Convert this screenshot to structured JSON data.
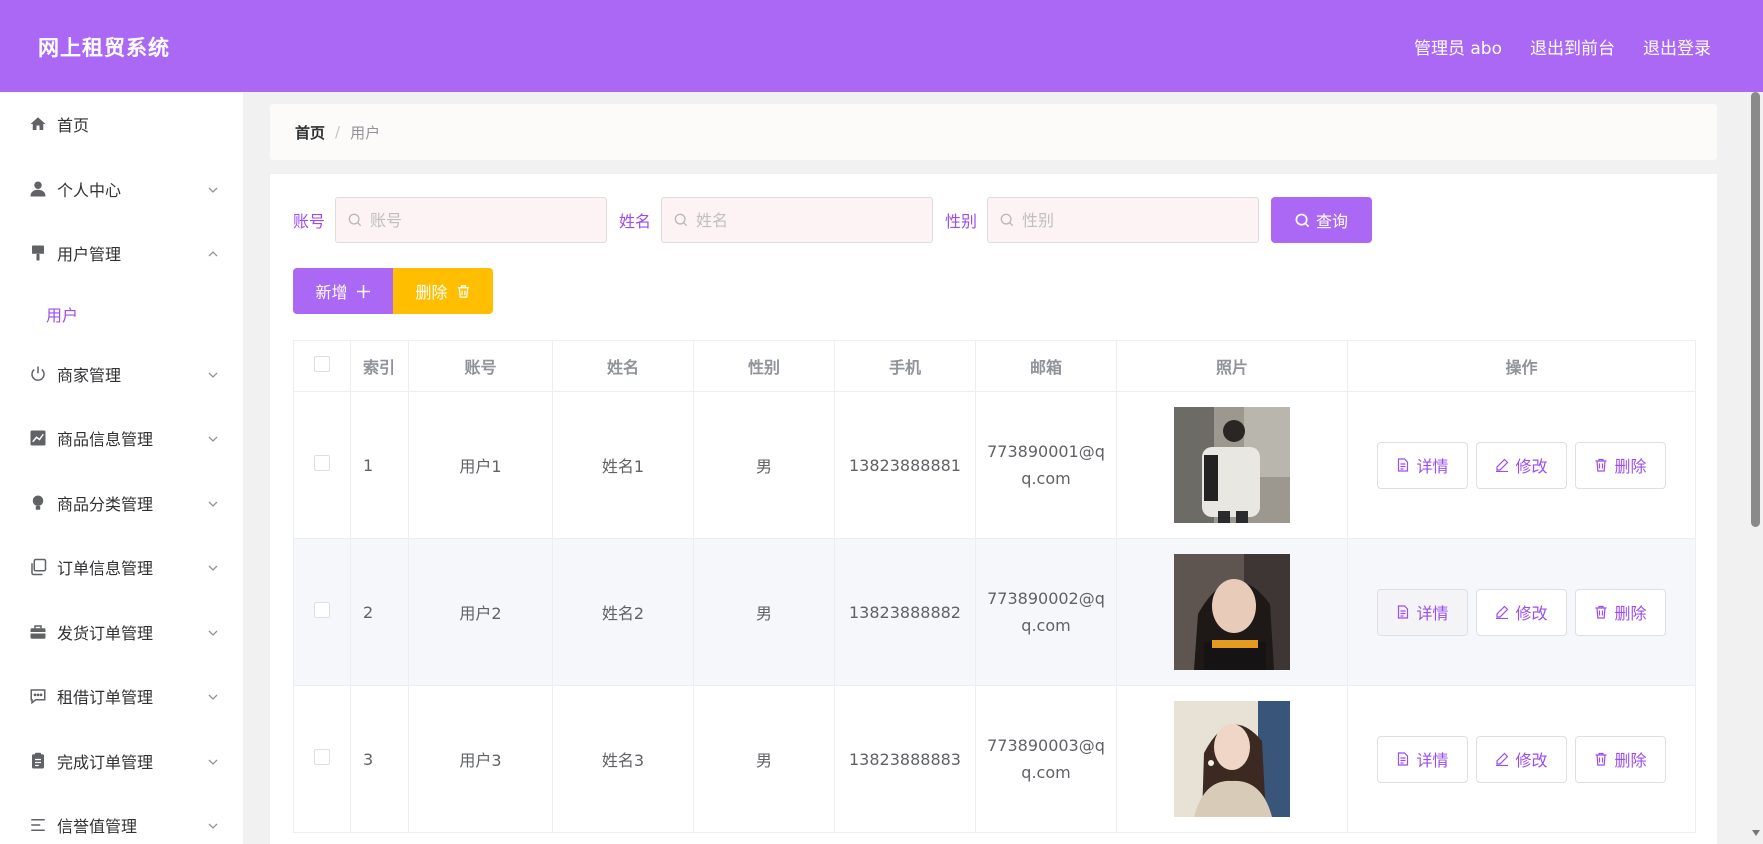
{
  "header": {
    "title": "网上租贸系统",
    "nav": [
      "管理员 abo",
      "退出到前台",
      "退出登录"
    ]
  },
  "sidebar": {
    "items": [
      {
        "label": "首页",
        "icon": "home-icon",
        "expandable": false
      },
      {
        "label": "个人中心",
        "icon": "user-icon",
        "expandable": true,
        "expanded": false
      },
      {
        "label": "用户管理",
        "icon": "brush-icon",
        "expandable": true,
        "expanded": true,
        "children": [
          "用户"
        ]
      },
      {
        "label": "商家管理",
        "icon": "power-icon",
        "expandable": true,
        "expanded": false
      },
      {
        "label": "商品信息管理",
        "icon": "chart-icon",
        "expandable": true,
        "expanded": false
      },
      {
        "label": "商品分类管理",
        "icon": "bulb-icon",
        "expandable": true,
        "expanded": false
      },
      {
        "label": "订单信息管理",
        "icon": "copy-icon",
        "expandable": true,
        "expanded": false
      },
      {
        "label": "发货订单管理",
        "icon": "suitcase-icon",
        "expandable": true,
        "expanded": false
      },
      {
        "label": "租借订单管理",
        "icon": "chat-icon",
        "expandable": true,
        "expanded": false
      },
      {
        "label": "完成订单管理",
        "icon": "clipboard-icon",
        "expandable": true,
        "expanded": false
      },
      {
        "label": "信誉值管理",
        "icon": "list-icon",
        "expandable": true,
        "expanded": false
      }
    ]
  },
  "breadcrumb": {
    "home": "首页",
    "separator": "/",
    "current": "用户"
  },
  "search": {
    "fields": [
      {
        "label": "账号",
        "placeholder": "账号"
      },
      {
        "label": "姓名",
        "placeholder": "姓名"
      },
      {
        "label": "性别",
        "placeholder": "性别"
      }
    ],
    "button": "查询"
  },
  "actions": {
    "add": "新增",
    "delete": "删除"
  },
  "table": {
    "headers": [
      "索引",
      "账号",
      "姓名",
      "性别",
      "手机",
      "邮箱",
      "照片",
      "操作"
    ],
    "rows": [
      {
        "index": "1",
        "account": "用户1",
        "name": "姓名1",
        "gender": "男",
        "phone": "13823888881",
        "email_a": "773890001@q",
        "email_b": "q.com"
      },
      {
        "index": "2",
        "account": "用户2",
        "name": "姓名2",
        "gender": "男",
        "phone": "13823888882",
        "email_a": "773890002@q",
        "email_b": "q.com"
      },
      {
        "index": "3",
        "account": "用户3",
        "name": "姓名3",
        "gender": "男",
        "phone": "13823888883",
        "email_a": "773890003@q",
        "email_b": "q.com"
      }
    ],
    "row_actions": {
      "detail": "详情",
      "edit": "修改",
      "delete": "删除"
    }
  },
  "colors": {
    "primary": "#ab68f5",
    "accent_text": "#9a4df0",
    "warning": "#ffbf00"
  }
}
